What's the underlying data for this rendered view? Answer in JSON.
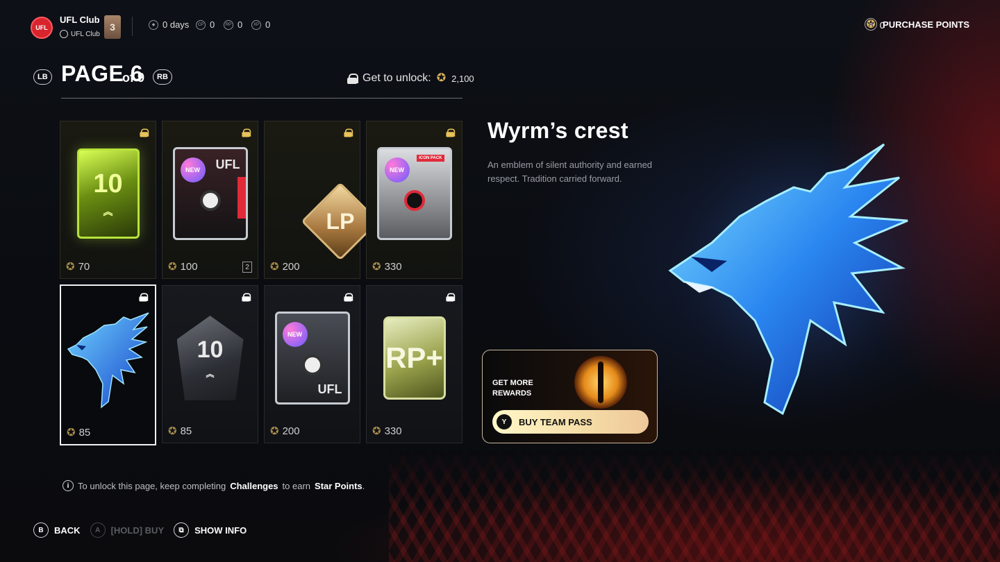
{
  "header": {
    "club_logo_text": "UFL",
    "club_name": "UFL Club",
    "club_sub": "UFL Club",
    "rank": "3",
    "stats": [
      {
        "icon": "shield-icon",
        "value": "0 days"
      },
      {
        "icon": "cp-icon",
        "icon_text": "CP",
        "value": "0"
      },
      {
        "icon": "rp-icon",
        "icon_text": "RP",
        "value": "0"
      },
      {
        "icon": "xp-icon",
        "icon_text": "XP",
        "value": "0"
      }
    ],
    "star_points": "0",
    "purchase_label": "PURCHASE POINTS"
  },
  "page": {
    "lb": "LB",
    "rb": "RB",
    "title": "PAGE 6",
    "of": "of 9",
    "unlock_label": "Get to unlock:",
    "unlock_value": "2,100"
  },
  "tiles": [
    {
      "name": "green-card",
      "price": "70",
      "style": "gold"
    },
    {
      "name": "new-pack",
      "price": "100",
      "qty": "2",
      "style": "gold",
      "badge": "NEW",
      "brand": "UFL"
    },
    {
      "name": "lp-diamond",
      "price": "200",
      "style": "gold",
      "art_text": "LP"
    },
    {
      "name": "white-pack",
      "price": "330",
      "style": "gold",
      "badge": "NEW",
      "tag": "ICON PACK"
    },
    {
      "name": "dragon-crest",
      "price": "85",
      "style": "selected"
    },
    {
      "name": "pentagon-badge",
      "price": "85",
      "style": "plain"
    },
    {
      "name": "dark-pack",
      "price": "200",
      "style": "plain",
      "badge": "NEW",
      "brand": "UFL"
    },
    {
      "name": "rp-card",
      "price": "330",
      "style": "plain",
      "art_text": "RP+"
    }
  ],
  "tile_art": {
    "ten": "10",
    "chev": "︽"
  },
  "detail": {
    "title": "Wyrm’s crest",
    "description": "An emblem of silent authority and earned respect. Tradition carried forward."
  },
  "team_pass": {
    "line1": "GET MORE",
    "line2": "REWARDS",
    "button_key": "Y",
    "button_label": "BUY TEAM PASS"
  },
  "hint": {
    "prefix": "To unlock this page, keep completing",
    "challenges": "Challenges",
    "middle": "to earn",
    "star_points": "Star Points",
    "suffix": "."
  },
  "controls": [
    {
      "key": "B",
      "label": "BACK",
      "enabled": true
    },
    {
      "key": "A",
      "label": "[HOLD] BUY",
      "enabled": false
    },
    {
      "key": "⧉",
      "label": "SHOW INFO",
      "enabled": true
    }
  ],
  "colors": {
    "accent_gold": "#d8b25a",
    "brand_red": "#d8242c",
    "dragon_blue": "#1e6fe0"
  }
}
